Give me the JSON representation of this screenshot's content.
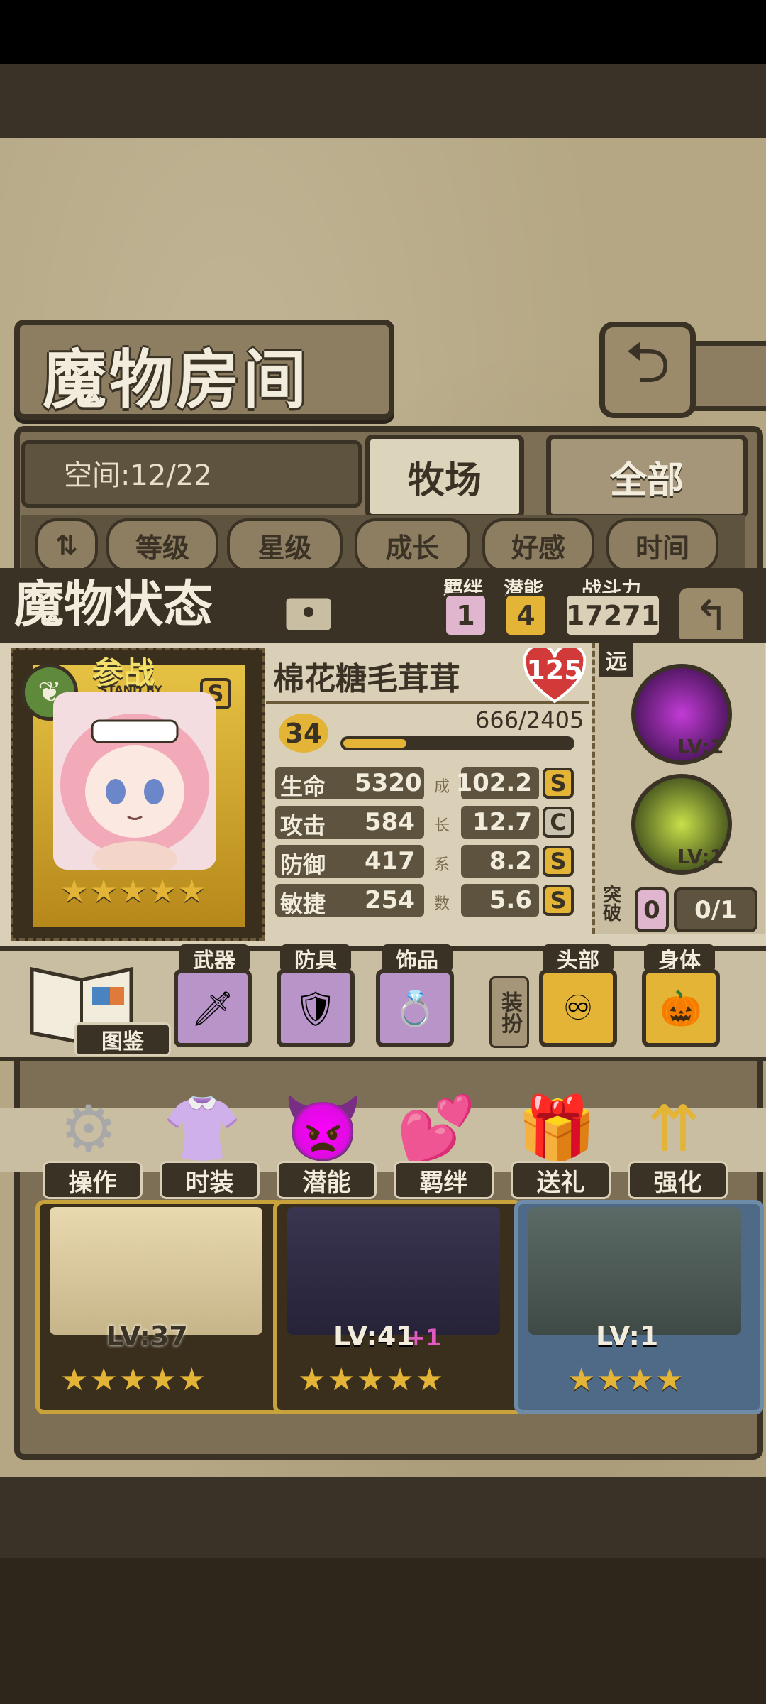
{
  "header": {
    "title": "魔物房间"
  },
  "space": {
    "label": "空间:12/22"
  },
  "tabs": [
    {
      "label": "牧场"
    },
    {
      "label": "全部"
    }
  ],
  "sort": {
    "items": [
      "等级",
      "星级",
      "成长",
      "好感",
      "时间"
    ]
  },
  "status": {
    "title": "魔物状态",
    "bond_label": "羁绊",
    "bond_value": "1",
    "potential_label": "潜能",
    "potential_value": "4",
    "power_label": "战斗力",
    "power_value": "17271"
  },
  "monster": {
    "name": "棉花糖毛茸茸",
    "heart_value": "125",
    "badge_main": "参战",
    "badge_sub": "STAND BY",
    "rank": "S",
    "level": "34",
    "exp": "666/2405",
    "exp_fraction": 0.277,
    "stars": "★★★★★",
    "growth_label": [
      "成",
      "长",
      "系",
      "数"
    ],
    "stats": [
      {
        "label": "生命",
        "value": "5320",
        "growth": "102.2",
        "grade": "S"
      },
      {
        "label": "攻击",
        "value": "584",
        "growth": "12.7",
        "grade": "C"
      },
      {
        "label": "防御",
        "value": "417",
        "growth": "8.2",
        "grade": "S"
      },
      {
        "label": "敏捷",
        "value": "254",
        "growth": "5.6",
        "grade": "S"
      }
    ]
  },
  "skills": {
    "range_label": "远",
    "skill1_level": "LV:1",
    "skill2_level": "LV:1",
    "breakthrough_label": "突破",
    "breakthrough_value": "0",
    "breakthrough_progress": "0/1"
  },
  "equipment": {
    "book_label": "图鉴",
    "weapon": "武器",
    "armor": "防具",
    "accessory": "饰品",
    "dress_label": "装扮",
    "head": "头部",
    "body": "身体"
  },
  "actions": [
    {
      "label": "操作"
    },
    {
      "label": "时装"
    },
    {
      "label": "潜能"
    },
    {
      "label": "羁绊"
    },
    {
      "label": "送礼"
    },
    {
      "label": "强化"
    }
  ],
  "monster_cards": [
    {
      "level": "LV:37",
      "stars": "★★★★★"
    },
    {
      "level": "LV:41",
      "bonus": "+1",
      "stars": "★★★★★"
    },
    {
      "level": "LV:1",
      "stars": "★★★★"
    }
  ]
}
